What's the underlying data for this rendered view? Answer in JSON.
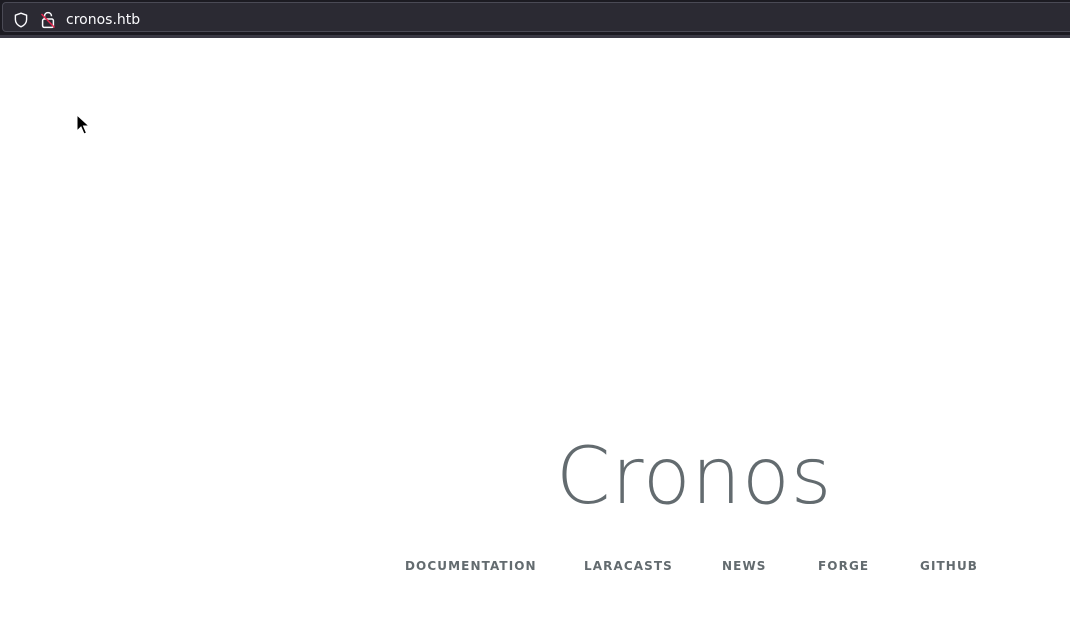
{
  "browser": {
    "url": "cronos.htb",
    "icons": {
      "shield": "shield-icon",
      "lock": "lock-insecure-icon"
    }
  },
  "page": {
    "title": "Cronos",
    "links": [
      {
        "label": "DOCUMENTATION"
      },
      {
        "label": "LARACASTS"
      },
      {
        "label": "NEWS"
      },
      {
        "label": "FORGE"
      },
      {
        "label": "GITHUB"
      }
    ]
  },
  "colors": {
    "toolbar_bg": "#1c1b22",
    "urlbar_bg": "#2b2a33",
    "url_text": "#fbfbfe",
    "lock_accent": "#e22850",
    "page_text": "#636b6f",
    "page_bg": "#ffffff"
  }
}
